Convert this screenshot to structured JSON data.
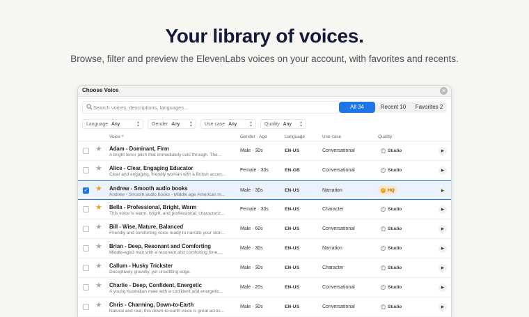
{
  "hero": {
    "title": "Your library of voices.",
    "subtitle": "Browse, filter and preview the ElevenLabs voices on your account, with favorites and recents."
  },
  "dialog": {
    "title": "Choose Voice",
    "close_icon": "close-icon",
    "search": {
      "placeholder": "Search voices, descriptions, languages...",
      "value": ""
    },
    "tabs": [
      {
        "label": "All 34",
        "active": true
      },
      {
        "label": "Recent 10",
        "active": false
      },
      {
        "label": "Favorites 2",
        "active": false
      }
    ],
    "filters": [
      {
        "label": "Language",
        "value": "Any"
      },
      {
        "label": "Gender",
        "value": "Any"
      },
      {
        "label": "Use case",
        "value": "Any"
      },
      {
        "label": "Quality",
        "value": "Any"
      }
    ],
    "columns": {
      "voice": "Voice ^",
      "gender_age": "Gender · Age",
      "language": "Language",
      "use_case": "Use case",
      "quality": "Quality"
    },
    "rows": [
      {
        "name": "Adam - Dominant, Firm",
        "desc": "A bright tenor pitch that immediately cuts through. The...",
        "gender_age": "Male · 30s",
        "language": "EN-US",
        "use_case": "Conversational",
        "quality": "Studio",
        "checked": false,
        "favorite": false,
        "selected": false
      },
      {
        "name": "Alice - Clear, Engaging Educator",
        "desc": "Clear and engaging, friendly woman with a British accen...",
        "gender_age": "Female · 30s",
        "language": "EN-GB",
        "use_case": "Conversational",
        "quality": "Studio",
        "checked": false,
        "favorite": false,
        "selected": false
      },
      {
        "name": "Andrew - Smooth audio books",
        "desc": "Andrew - Smooth audio books - Middle age American m...",
        "gender_age": "Male · 30s",
        "language": "EN-US",
        "use_case": "Narration",
        "quality": "HQ",
        "checked": true,
        "favorite": true,
        "selected": true
      },
      {
        "name": "Bella - Professional, Bright, Warm",
        "desc": "This voice is warm, bright, and professional, characteriz...",
        "gender_age": "Female · 30s",
        "language": "EN-US",
        "use_case": "Character",
        "quality": "Studio",
        "checked": false,
        "favorite": true,
        "selected": false
      },
      {
        "name": "Bill - Wise, Mature, Balanced",
        "desc": "Friendly and comforting voice ready to narrate your stori...",
        "gender_age": "Male · 60s",
        "language": "EN-US",
        "use_case": "Conversational",
        "quality": "Studio",
        "checked": false,
        "favorite": false,
        "selected": false
      },
      {
        "name": "Brian - Deep, Resonant and Comforting",
        "desc": "Middle-aged man with a resonant and comforting tone....",
        "gender_age": "Male · 30s",
        "language": "EN-US",
        "use_case": "Narration",
        "quality": "Studio",
        "checked": false,
        "favorite": false,
        "selected": false
      },
      {
        "name": "Callum - Husky Trickster",
        "desc": "Deceptively gravelly, yet unsettling edge.",
        "gender_age": "Male · 30s",
        "language": "EN-US",
        "use_case": "Character",
        "quality": "Studio",
        "checked": false,
        "favorite": false,
        "selected": false
      },
      {
        "name": "Charlie - Deep, Confident, Energetic",
        "desc": "A young Australian male with a confident and energetic...",
        "gender_age": "Male · 20s",
        "language": "EN-US",
        "use_case": "Conversational",
        "quality": "Studio",
        "checked": false,
        "favorite": false,
        "selected": false
      },
      {
        "name": "Chris - Charming, Down-to-Earth",
        "desc": "Natural and real, this down-to-earth voice is great acros...",
        "gender_age": "Male · 30s",
        "language": "EN-US",
        "use_case": "Conversational",
        "quality": "Studio",
        "checked": false,
        "favorite": false,
        "selected": false
      }
    ],
    "colors": {
      "accent": "#1f74e6",
      "favorite": "#e9a21d",
      "hq_badge": "#fbe7c7"
    }
  }
}
